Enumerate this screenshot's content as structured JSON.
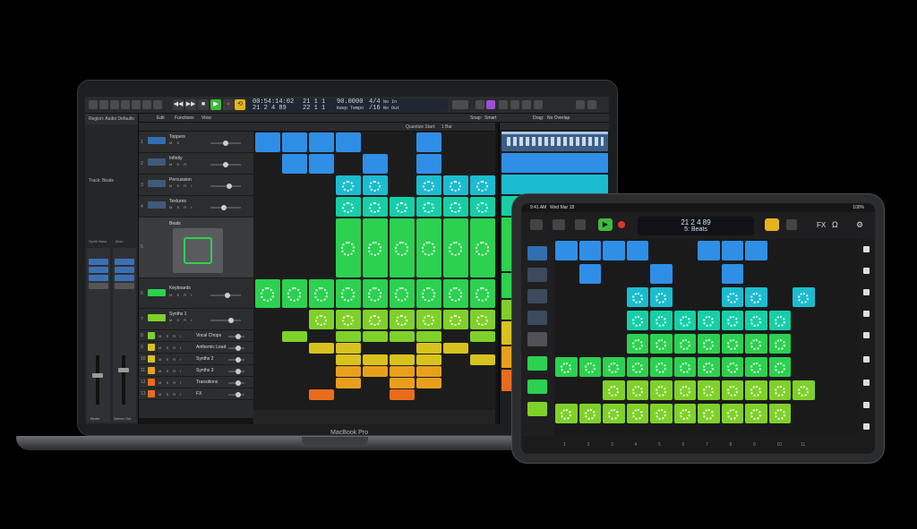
{
  "macbook": {
    "label": "MacBook Pro",
    "lcd": {
      "time": "00:54:14:02",
      "bars_top": "21  1  1",
      "bars_bottom": "21  2  4  89",
      "bars_bottom2": "22  1  1",
      "tempo": "90.0000",
      "tempo_label": "Keep Tempo",
      "sig": "4/4",
      "division": "/16",
      "in": "No In",
      "out": "No Out"
    },
    "menubar": {
      "region": "Region: Audio Defaults",
      "edit": "Edit",
      "functions": "Functions",
      "view": "View",
      "snap_label": "Snap:",
      "snap_value": "Smart",
      "drag_label": "Drag:",
      "drag_value": "No Overlap"
    },
    "inspector": {
      "tracks_header": "Track: Beats",
      "strip_a": "Synth Bass",
      "strip_b": "Main",
      "bottom_a": "Beats",
      "bottom_b": "Stereo Out"
    },
    "grid_header": "Quantize Start:",
    "grid_quantize": "1 Bar",
    "tracks": [
      {
        "num": "1",
        "name": "Toppers"
      },
      {
        "num": "2",
        "name": "Infinity"
      },
      {
        "num": "3",
        "name": "Percussion"
      },
      {
        "num": "4",
        "name": "Textures"
      },
      {
        "num": "5",
        "name": "Beats"
      },
      {
        "num": "6",
        "name": "Keyboards"
      },
      {
        "num": "7",
        "name": "Synths 1"
      },
      {
        "num": "8",
        "name": "Vocal Chops"
      },
      {
        "num": "9",
        "name": "Anthemic Lead"
      },
      {
        "num": "10",
        "name": "Synths 2"
      },
      {
        "num": "11",
        "name": "Synths 3"
      },
      {
        "num": "12",
        "name": "Transitions"
      },
      {
        "num": "13",
        "name": "FX"
      }
    ]
  },
  "ipad": {
    "status_time": "9:41 AM",
    "status_date": "Wed Mar 18",
    "status_battery": "100%",
    "lcd_position": "21  2  4  89",
    "lcd_track": "5: Beats",
    "fx_label": "FX",
    "scene_numbers": [
      "1",
      "2",
      "3",
      "4",
      "5",
      "6",
      "7",
      "8",
      "9",
      "10",
      "11"
    ]
  },
  "colors": {
    "blue": "#2f8fe6",
    "cyan": "#1bbcd0",
    "teal": "#16cfa6",
    "green": "#2bd14f",
    "lime": "#7fd12a",
    "yellow": "#d8c21e",
    "orange": "#e8a01c",
    "red_orange": "#e86c1c",
    "play_green": "#3fb93f",
    "record_red": "#e0342c",
    "cycle_yellow": "#e5b41c"
  }
}
